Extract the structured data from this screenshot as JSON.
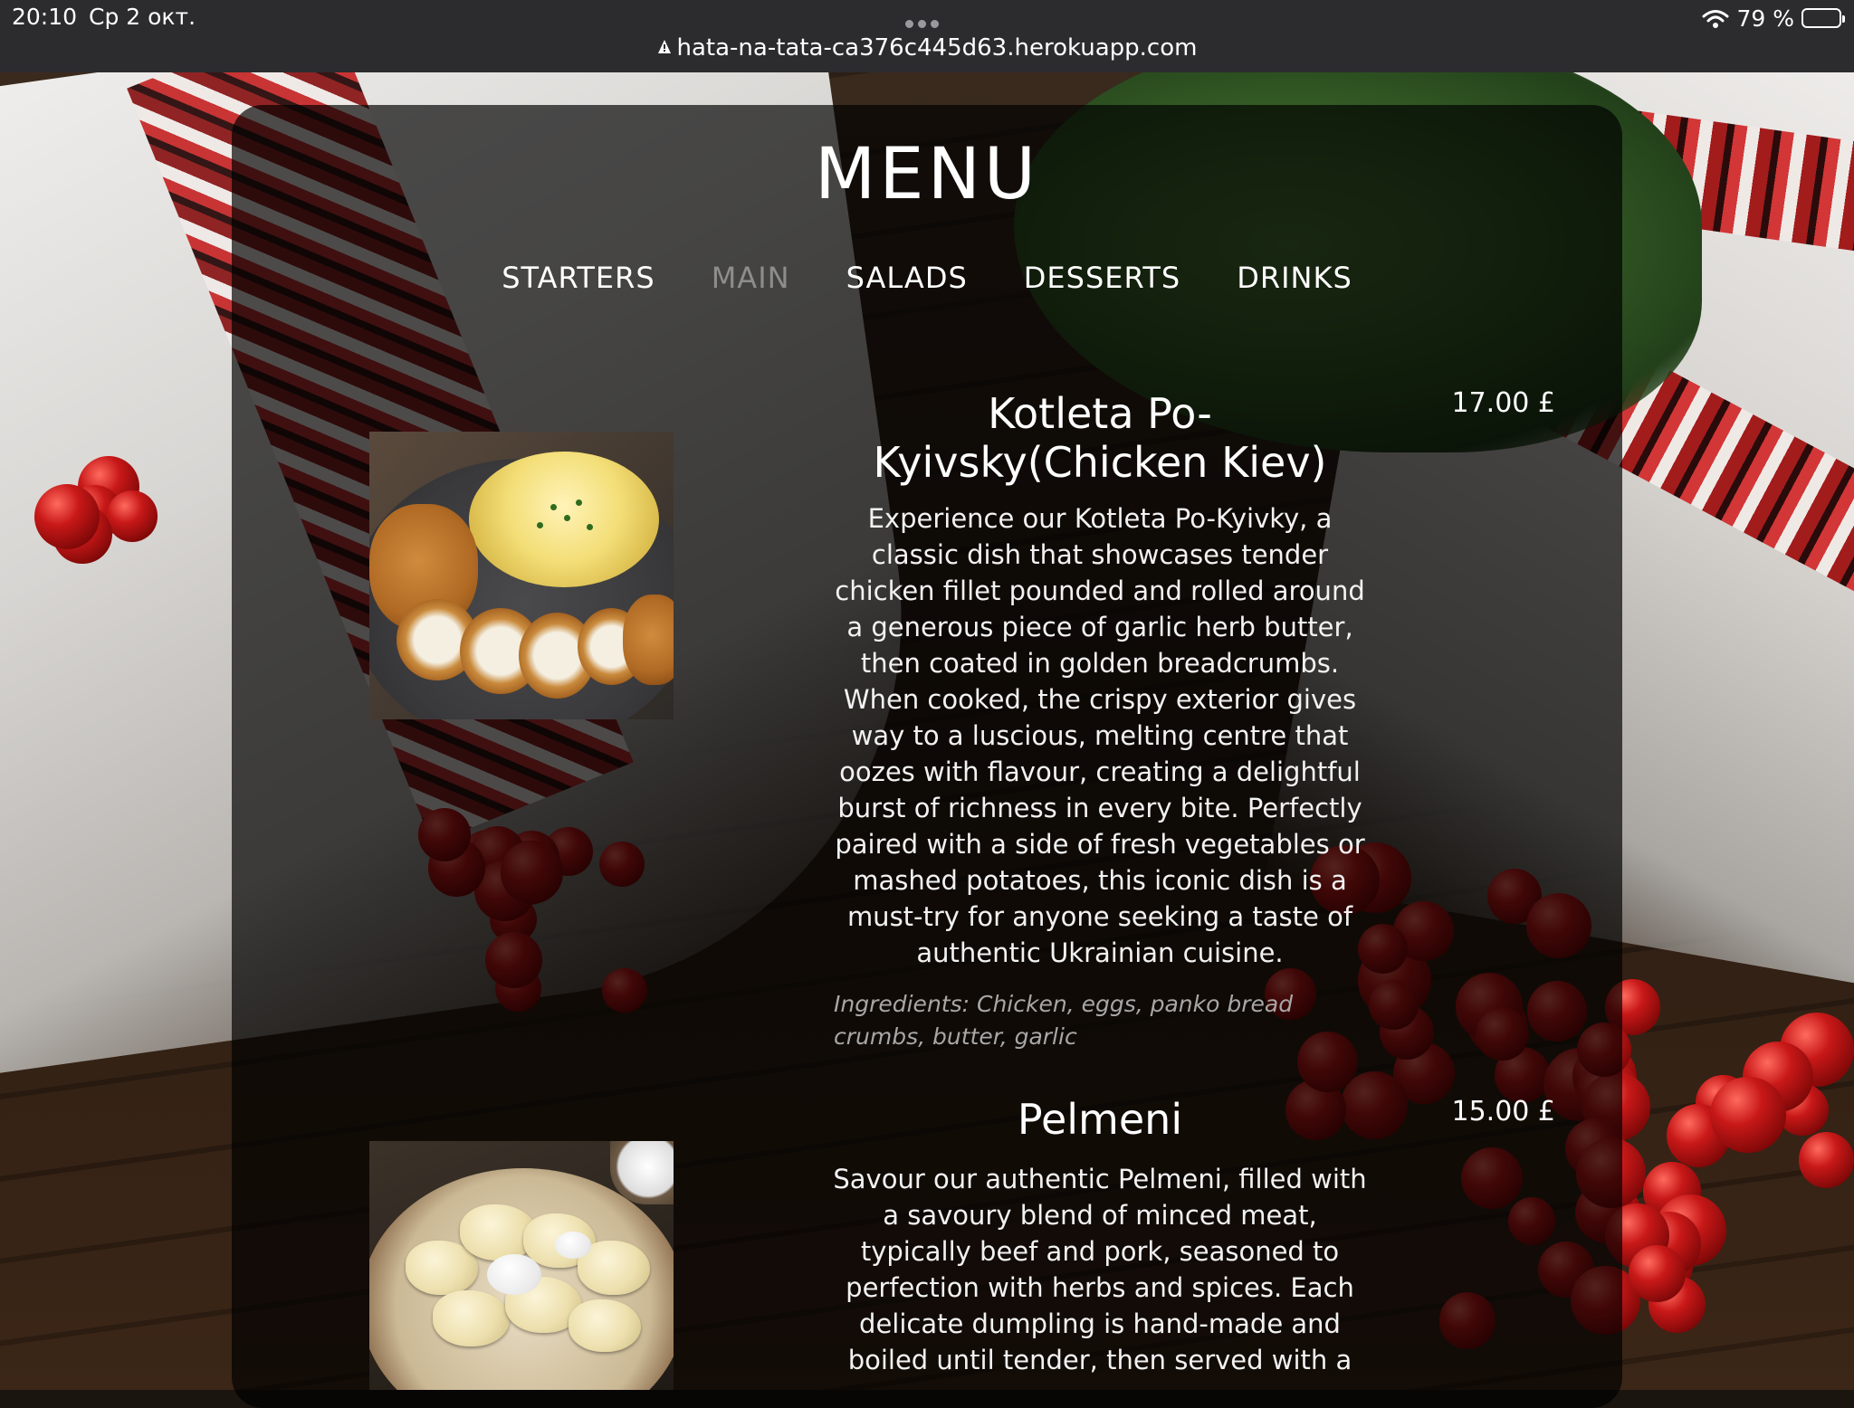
{
  "status_bar": {
    "time": "20:10",
    "date": "Ср 2 окт.",
    "battery": "79 %",
    "battery_level": 0.79
  },
  "browser": {
    "url": "hata-na-tata-ca376c445d63.herokuapp.com"
  },
  "page": {
    "title": "MENU",
    "tabs": [
      {
        "label": "STARTERS",
        "active": false
      },
      {
        "label": "MAIN",
        "active": true
      },
      {
        "label": "SALADS",
        "active": false
      },
      {
        "label": "DESSERTS",
        "active": false
      },
      {
        "label": "DRINKS",
        "active": false
      }
    ]
  },
  "dishes": [
    {
      "title_line1": "Kotleta Po-",
      "title_line2": "Kyivsky(Chicken Kiev)",
      "price": "17.00 £",
      "description_lines": [
        "Experience our Kotleta Po-Kyivky, a",
        "classic dish that showcases tender",
        "chicken fillet pounded and rolled around",
        "a generous piece of garlic herb butter,",
        "then coated in golden breadcrumbs.",
        "When cooked, the crispy exterior gives",
        "way to a luscious, melting centre that",
        "oozes with flavour, creating a delightful",
        "burst of richness in every bite. Perfectly",
        "paired with a side of fresh vegetables or",
        "mashed potatoes, this iconic dish is a",
        "must-try for anyone seeking a taste of",
        "authentic Ukrainian cuisine."
      ],
      "ingredients_line1": "Ingredients: Chicken, eggs, panko bread",
      "ingredients_line2": "crumbs, butter, garlic"
    },
    {
      "title": "Pelmeni",
      "price": "15.00 £",
      "description_lines": [
        "Savour our authentic Pelmeni, filled with",
        "a savoury blend of minced meat,",
        "typically beef and pork, seasoned to",
        "perfection with herbs and spices. Each",
        "delicate dumpling is hand-made and",
        "boiled until tender, then served with a"
      ]
    }
  ],
  "colors": {
    "active_tab": "#8d8d8d",
    "ingredients_text": "#a7a7a7",
    "panel": "rgba(0,0,0,0.68)"
  },
  "icons": [
    "lock-icon",
    "wifi-icon",
    "battery-icon",
    "more-dots-icon"
  ]
}
